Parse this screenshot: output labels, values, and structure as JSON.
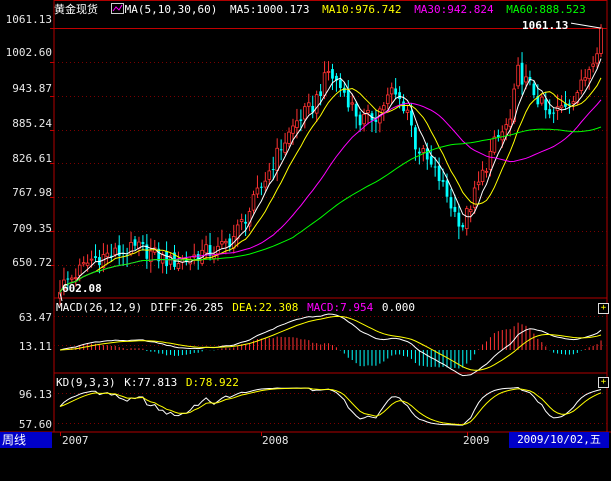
{
  "main_header": {
    "instrument": "黄金现货",
    "ma_label": "MA(5,10,30,60)",
    "ma5": "MA5:1000.173",
    "ma10": "MA10:976.742",
    "ma30": "MA30:942.824",
    "ma60": "MA60:888.523"
  },
  "macd_header": {
    "label": "MACD(26,12,9)",
    "diff": "DIFF:26.285",
    "dea": "DEA:22.308",
    "macd": "MACD:7.954",
    "zero": "0.000"
  },
  "kd_header": {
    "label": "KD(9,3,3)",
    "k": "K:77.813",
    "d": "D:78.922"
  },
  "annotations": {
    "high": "1061.13",
    "low": "602.08"
  },
  "footer": {
    "period_tab": "周线",
    "date": "2009/10/02,五"
  },
  "colors": {
    "up": "#ff3232",
    "down": "#00ffff",
    "ma5": "#ffffff",
    "ma10": "#ffff00",
    "ma30": "#ff00ff",
    "ma60": "#00ff00",
    "grid": "#7a0000",
    "accent": "#0000c8"
  },
  "chart_data": [
    {
      "type": "candlestick",
      "title": "黄金现货",
      "y_ticks": [
        1061.13,
        1002.6,
        943.87,
        885.24,
        826.61,
        767.98,
        709.35,
        650.72
      ],
      "y_tick_labels": [
        "1061.13",
        "1002.60",
        "943.87",
        "885.24",
        "826.61",
        "767.98",
        "709.35",
        "650.72"
      ],
      "ylim": [
        602,
        1075
      ],
      "x_tick_labels": [
        "2007",
        "2008",
        "2009"
      ],
      "x_ticks_at_bar": [
        0,
        51,
        103
      ],
      "bars_count": 138,
      "anchor_closes": [
        [
          0,
          612
        ],
        [
          4,
          635
        ],
        [
          8,
          660
        ],
        [
          12,
          668
        ],
        [
          16,
          672
        ],
        [
          20,
          680
        ],
        [
          24,
          668
        ],
        [
          28,
          655
        ],
        [
          32,
          660
        ],
        [
          36,
          672
        ],
        [
          40,
          675
        ],
        [
          44,
          700
        ],
        [
          48,
          745
        ],
        [
          52,
          800
        ],
        [
          56,
          855
        ],
        [
          60,
          900
        ],
        [
          64,
          925
        ],
        [
          68,
          985
        ],
        [
          72,
          950
        ],
        [
          76,
          900
        ],
        [
          80,
          910
        ],
        [
          84,
          950
        ],
        [
          88,
          920
        ],
        [
          90,
          860
        ],
        [
          93,
          830
        ],
        [
          96,
          800
        ],
        [
          100,
          740
        ],
        [
          102,
          720
        ],
        [
          106,
          790
        ],
        [
          110,
          860
        ],
        [
          114,
          900
        ],
        [
          116,
          985
        ],
        [
          120,
          950
        ],
        [
          124,
          905
        ],
        [
          128,
          930
        ],
        [
          132,
          960
        ],
        [
          136,
          1030
        ],
        [
          137,
          1061
        ]
      ],
      "series": [
        {
          "name": "MA5",
          "window": 5
        },
        {
          "name": "MA10",
          "window": 10
        },
        {
          "name": "MA30",
          "window": 30
        },
        {
          "name": "MA60",
          "window": 60
        }
      ]
    },
    {
      "type": "bar",
      "title": "MACD(26,12,9)",
      "y_tick_labels": [
        "63.47",
        "13.11"
      ],
      "y_ticks": [
        63.47,
        13.11
      ],
      "series": [
        {
          "name": "DIFF"
        },
        {
          "name": "DEA"
        },
        {
          "name": "MACD"
        }
      ]
    },
    {
      "type": "line",
      "title": "KD(9,3,3)",
      "y_tick_labels": [
        "96.13",
        "57.60"
      ],
      "y_ticks": [
        96.13,
        57.6
      ],
      "series": [
        {
          "name": "K"
        },
        {
          "name": "D"
        }
      ]
    }
  ]
}
